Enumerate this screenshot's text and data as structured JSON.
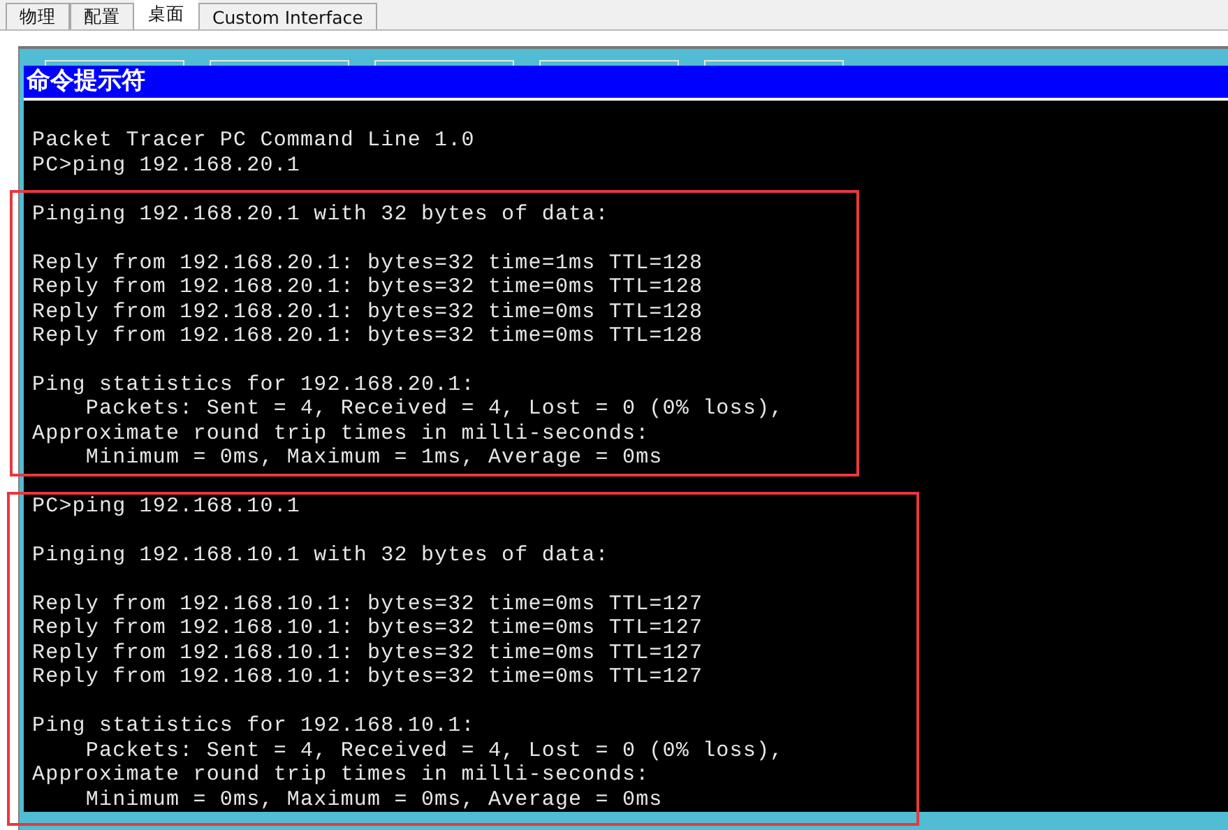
{
  "tabs": [
    {
      "label": "物理",
      "selected": false
    },
    {
      "label": "配置",
      "selected": false
    },
    {
      "label": "桌面",
      "selected": true
    },
    {
      "label": "Custom Interface",
      "selected": false
    }
  ],
  "command_prompt": {
    "title": "命令提示符",
    "blocks": [
      [
        "Packet Tracer PC Command Line 1.0",
        "PC>ping 192.168.20.1"
      ],
      [
        "Pinging 192.168.20.1 with 32 bytes of data:"
      ],
      [
        "Reply from 192.168.20.1: bytes=32 time=1ms TTL=128",
        "Reply from 192.168.20.1: bytes=32 time=0ms TTL=128",
        "Reply from 192.168.20.1: bytes=32 time=0ms TTL=128",
        "Reply from 192.168.20.1: bytes=32 time=0ms TTL=128"
      ],
      [
        "Ping statistics for 192.168.20.1:",
        "    Packets: Sent = 4, Received = 4, Lost = 0 (0% loss),",
        "Approximate round trip times in milli-seconds:",
        "    Minimum = 0ms, Maximum = 1ms, Average = 0ms"
      ],
      [
        "PC>ping 192.168.10.1"
      ],
      [
        "Pinging 192.168.10.1 with 32 bytes of data:"
      ],
      [
        "Reply from 192.168.10.1: bytes=32 time=0ms TTL=127",
        "Reply from 192.168.10.1: bytes=32 time=0ms TTL=127",
        "Reply from 192.168.10.1: bytes=32 time=0ms TTL=127",
        "Reply from 192.168.10.1: bytes=32 time=0ms TTL=127"
      ],
      [
        "Ping statistics for 192.168.10.1:",
        "    Packets: Sent = 4, Received = 4, Lost = 0 (0% loss),",
        "Approximate round trip times in milli-seconds:",
        "    Minimum = 0ms, Maximum = 0ms, Average = 0ms"
      ]
    ]
  }
}
